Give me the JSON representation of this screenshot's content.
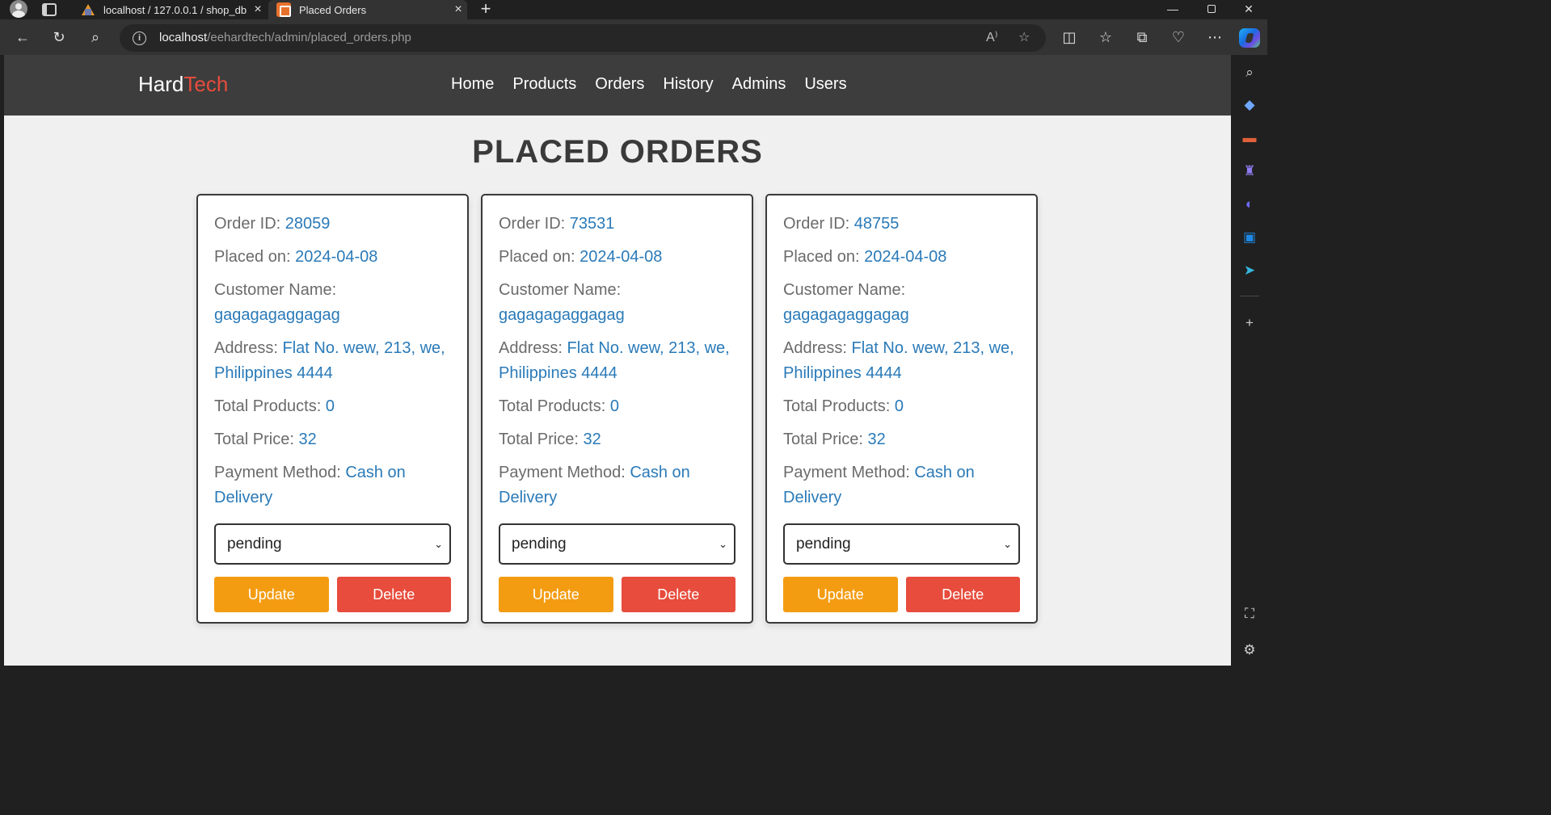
{
  "browser": {
    "tabs": [
      {
        "title": "localhost / 127.0.0.1 / shop_db | ",
        "close": "×",
        "favicon": "phpmyadmin-icon"
      },
      {
        "title": "Placed Orders",
        "close": "×",
        "favicon": "site-icon"
      }
    ],
    "new_tab": "+",
    "address": {
      "host": "localhost",
      "path": "/eehardtech/admin/placed_orders.php"
    }
  },
  "site": {
    "logo_part1": "Hard",
    "logo_part2": "Tech",
    "nav": [
      "Home",
      "Products",
      "Orders",
      "History",
      "Admins",
      "Users"
    ]
  },
  "page_title": "PLACED ORDERS",
  "labels": {
    "order_id": "Order ID: ",
    "placed_on": "Placed on: ",
    "customer_name": "Customer Name:",
    "address": "Address: ",
    "total_products": "Total Products: ",
    "total_price": "Total Price: ",
    "payment_method": "Payment Method: ",
    "update": "Update",
    "delete": "Delete"
  },
  "orders": [
    {
      "id": "28059",
      "placed_on": "2024-04-08",
      "customer": "gagagagaggagag",
      "address": "Flat No. wew, 213, we, Philippines 4444",
      "total_products": "0",
      "total_price": "32",
      "payment_method": "Cash on Delivery",
      "status": "pending"
    },
    {
      "id": "73531",
      "placed_on": "2024-04-08",
      "customer": "gagagagaggagag",
      "address": "Flat No. wew, 213, we, Philippines 4444",
      "total_products": "0",
      "total_price": "32",
      "payment_method": "Cash on Delivery",
      "status": "pending"
    },
    {
      "id": "48755",
      "placed_on": "2024-04-08",
      "customer": "gagagagaggagag",
      "address": "Flat No. wew, 213, we, Philippines 4444",
      "total_products": "0",
      "total_price": "32",
      "payment_method": "Cash on Delivery",
      "status": "pending"
    }
  ],
  "colors": {
    "brand_accent": "#e74c3c",
    "value_text": "#2a7ab8",
    "update_button": "#f39c12",
    "delete_button": "#e74c3c",
    "header_bg": "#3d3d3d"
  }
}
